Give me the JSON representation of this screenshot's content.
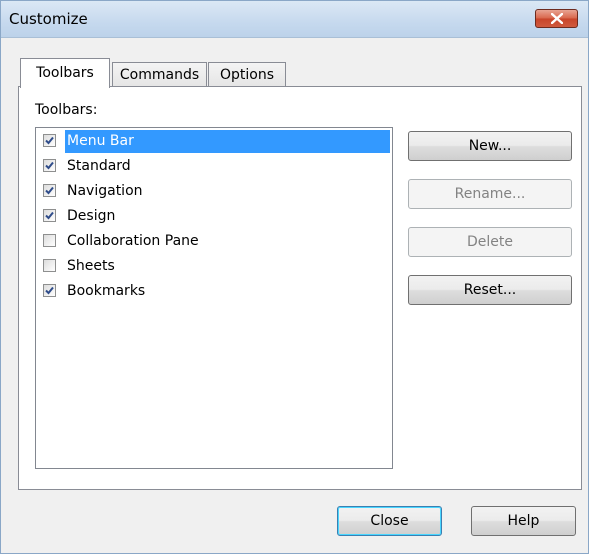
{
  "window": {
    "title": "Customize"
  },
  "tabs": [
    {
      "label": "Toolbars",
      "active": true
    },
    {
      "label": "Commands",
      "active": false
    },
    {
      "label": "Options",
      "active": false
    }
  ],
  "toolbars_panel": {
    "group_label": "Toolbars:",
    "items": [
      {
        "label": "Menu Bar",
        "checked": true,
        "selected": true
      },
      {
        "label": "Standard",
        "checked": true,
        "selected": false
      },
      {
        "label": "Navigation",
        "checked": true,
        "selected": false
      },
      {
        "label": "Design",
        "checked": true,
        "selected": false
      },
      {
        "label": "Collaboration Pane",
        "checked": false,
        "selected": false
      },
      {
        "label": "Sheets",
        "checked": false,
        "selected": false
      },
      {
        "label": "Bookmarks",
        "checked": true,
        "selected": false
      }
    ],
    "buttons": {
      "new": "New...",
      "rename": "Rename...",
      "delete": "Delete",
      "reset": "Reset..."
    }
  },
  "footer": {
    "close": "Close",
    "help": "Help"
  },
  "colors": {
    "selection": "#3399ff",
    "close_button": "#c8452a"
  }
}
